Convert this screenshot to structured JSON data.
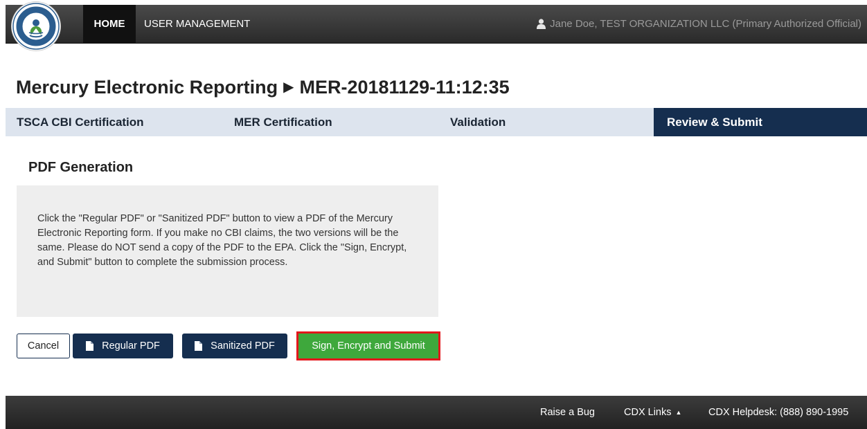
{
  "nav": {
    "home": "HOME",
    "user_management": "USER MANAGEMENT",
    "user": "Jane Doe, TEST ORGANIZATION LLC (Primary Authorized Official)",
    "logo_icon": "epa-seal-logo",
    "user_icon": "user-icon"
  },
  "title": {
    "app": "Mercury Electronic Reporting",
    "separator": "▶",
    "report_id": "MER-20181129-11:12:35"
  },
  "steps": [
    {
      "label": "TSCA CBI Certification",
      "active": false
    },
    {
      "label": "MER Certification",
      "active": false
    },
    {
      "label": "Validation",
      "active": false
    },
    {
      "label": "Review & Submit",
      "active": true
    }
  ],
  "section": {
    "heading": "PDF Generation",
    "description": "Click the \"Regular PDF\" or \"Sanitized PDF\" button to view a PDF of the Mercury Electronic Reporting form. If you make no CBI claims, the two versions will be the same. Please do NOT send a copy of the PDF to the EPA. Click the \"Sign, Encrypt, and Submit\" button to complete the submission process."
  },
  "buttons": {
    "cancel": "Cancel",
    "regular_pdf": "Regular PDF",
    "sanitized_pdf": "Sanitized PDF",
    "submit": "Sign, Encrypt and Submit"
  },
  "footer": {
    "raise_bug": "Raise a Bug",
    "cdx_links": "CDX Links",
    "cdx_links_caret": "▲",
    "helpdesk": "CDX Helpdesk: (888) 890-1995"
  },
  "colors": {
    "navy": "#152e4f",
    "steps_bg": "#dde4ee",
    "submit_green": "#3ea83c",
    "highlight_red": "#e3161b"
  }
}
